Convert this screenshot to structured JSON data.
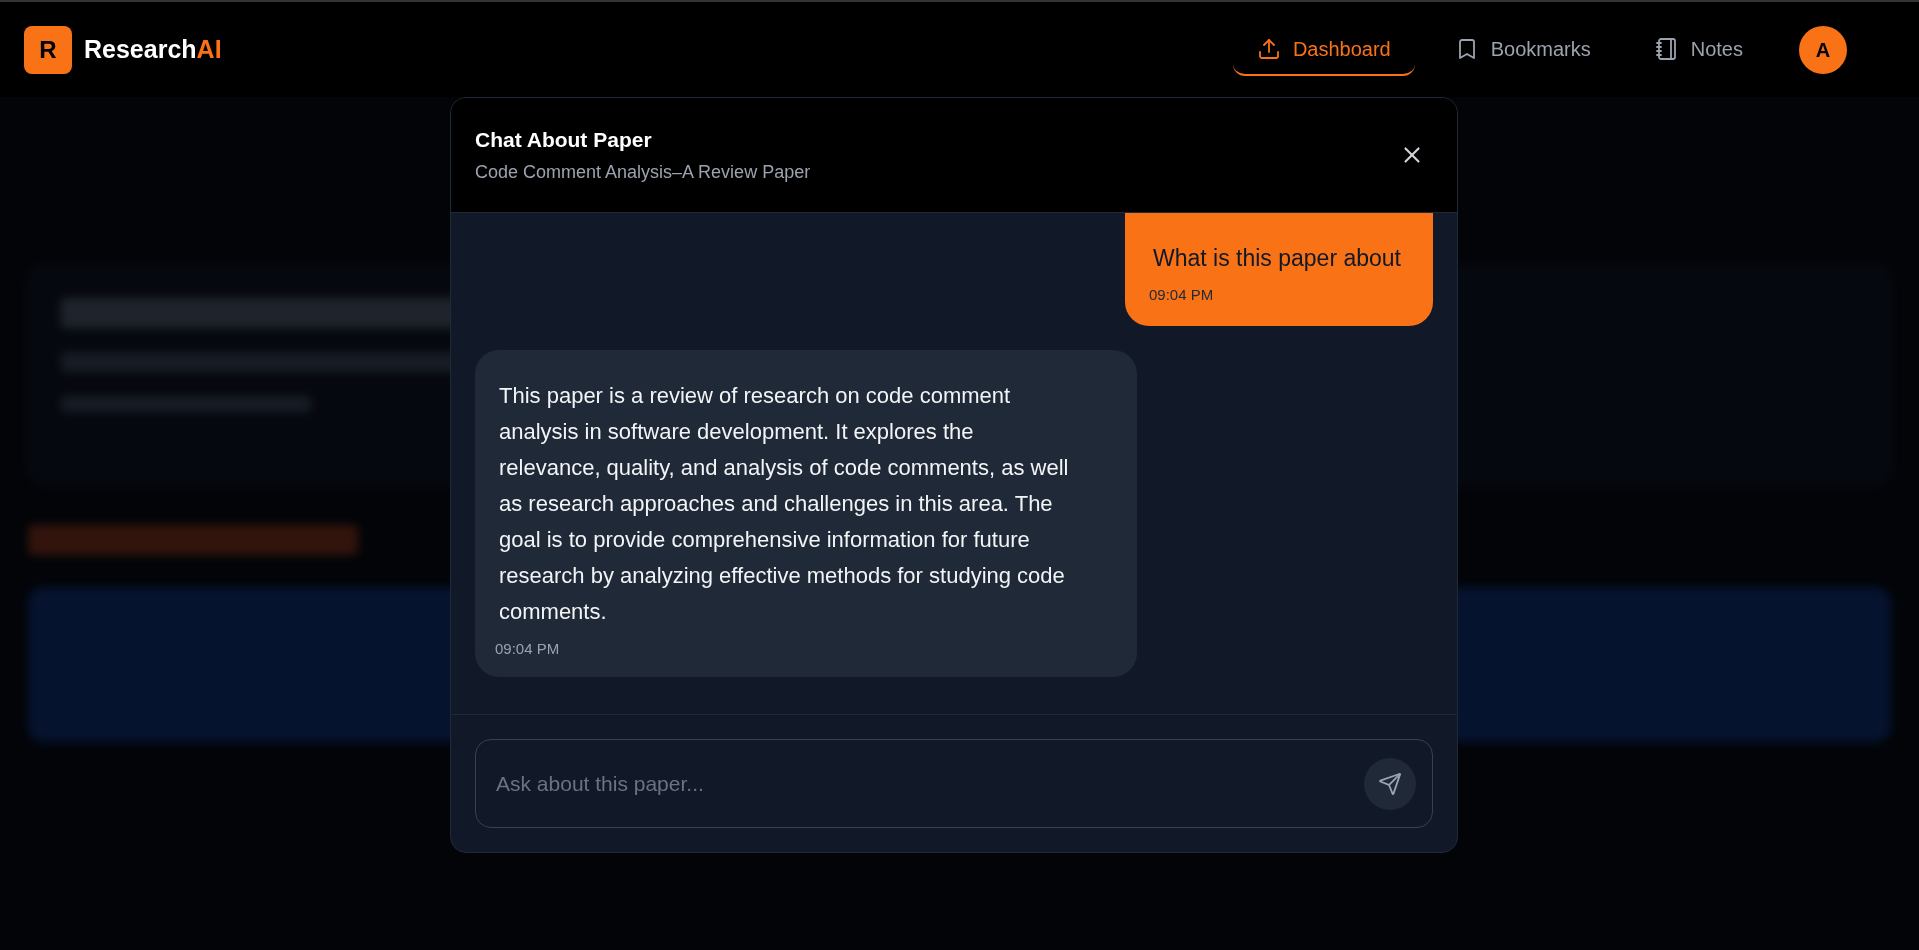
{
  "app": {
    "logo_letter": "R",
    "name": "Research",
    "name_accent": "AI"
  },
  "nav": [
    {
      "label": "Dashboard",
      "kind": "upload",
      "selected": true
    },
    {
      "label": "Bookmarks",
      "kind": "bookmark",
      "selected": false
    },
    {
      "label": "Notes",
      "kind": "notebook",
      "selected": false
    }
  ],
  "avatar": "A",
  "dialog": {
    "title": "Chat About Paper",
    "subtitle": "Code Comment Analysis–A Review Paper"
  },
  "messages": [
    {
      "kind": "sent",
      "text": "What is this paper about",
      "time": "09:04 PM"
    },
    {
      "kind": "received",
      "text": "This paper is a review of research on code comment analysis in software development. It explores the relevance, quality, and analysis of code comments, as well as research approaches and challenges in this area. The goal is to provide comprehensive information for future research by analyzing effective methods for studying code comments.",
      "time": "09:04 PM"
    }
  ],
  "input": {
    "placeholder": "Ask about this paper..."
  }
}
